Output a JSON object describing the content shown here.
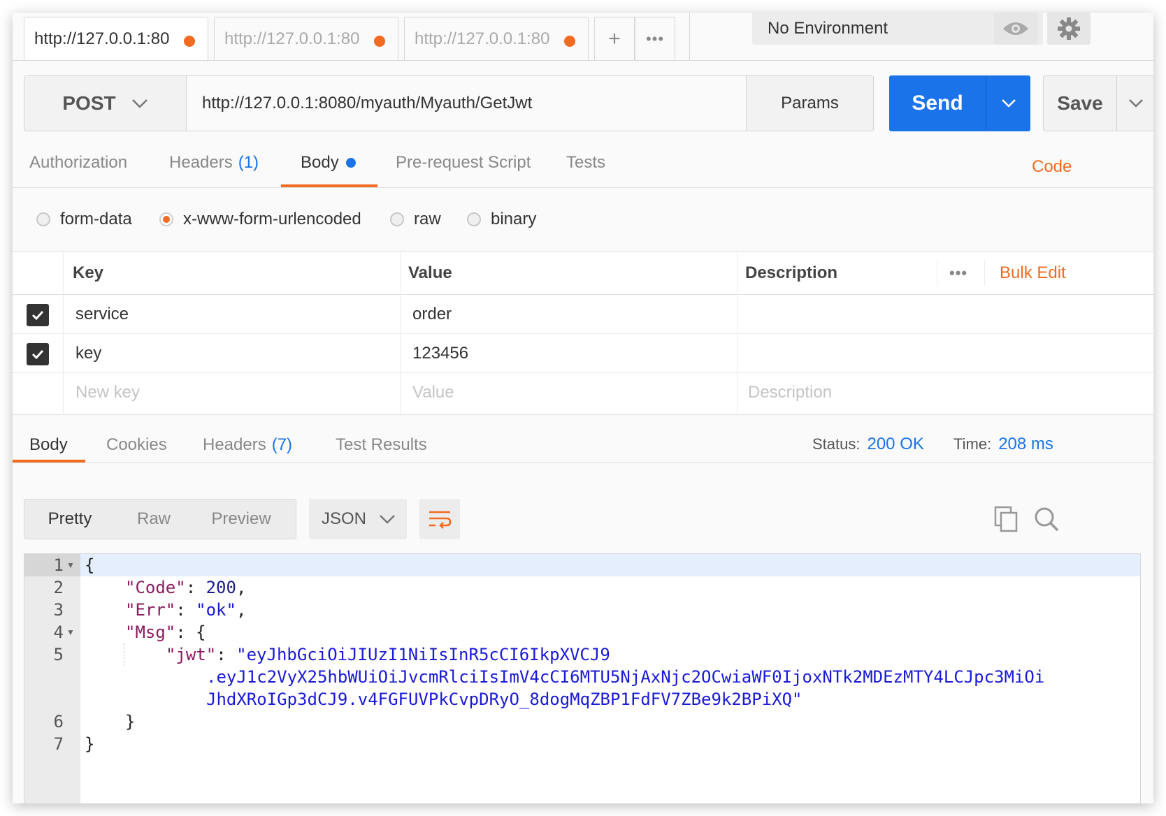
{
  "tabs": [
    {
      "label": "http://127.0.0.1:80",
      "active": true
    },
    {
      "label": "http://127.0.0.1:80",
      "active": false
    },
    {
      "label": "http://127.0.0.1:80",
      "active": false
    }
  ],
  "tab_actions": {
    "add": "+",
    "more": "•••"
  },
  "environment": {
    "selected": "No Environment"
  },
  "request": {
    "method": "POST",
    "url": "http://127.0.0.1:8080/myauth/Myauth/GetJwt",
    "params_label": "Params",
    "send_label": "Send",
    "save_label": "Save"
  },
  "request_tabs": {
    "authorization": "Authorization",
    "headers": "Headers",
    "headers_count": "(1)",
    "body": "Body",
    "prerequest": "Pre-request Script",
    "tests": "Tests",
    "code": "Code"
  },
  "body_modes": [
    {
      "label": "form-data",
      "selected": false
    },
    {
      "label": "x-www-form-urlencoded",
      "selected": true
    },
    {
      "label": "raw",
      "selected": false
    },
    {
      "label": "binary",
      "selected": false
    }
  ],
  "params_table": {
    "headers": {
      "key": "Key",
      "value": "Value",
      "description": "Description",
      "more": "•••",
      "bulk_edit": "Bulk Edit"
    },
    "rows": [
      {
        "checked": true,
        "key": "service",
        "value": "order",
        "description": ""
      },
      {
        "checked": true,
        "key": "key",
        "value": "123456",
        "description": ""
      }
    ],
    "placeholders": {
      "key": "New key",
      "value": "Value",
      "description": "Description"
    }
  },
  "response": {
    "tabs": {
      "body": "Body",
      "cookies": "Cookies",
      "headers": "Headers",
      "headers_count": "(7)",
      "test_results": "Test Results"
    },
    "status_label": "Status:",
    "status_value": "200 OK",
    "time_label": "Time:",
    "time_value": "208 ms",
    "views": {
      "pretty": "Pretty",
      "raw": "Raw",
      "preview": "Preview"
    },
    "format": "JSON"
  },
  "code_lines": {
    "l1": "{",
    "l2_key": "\"Code\"",
    "l2_val": "200",
    "l3_key": "\"Err\"",
    "l3_val": "\"ok\"",
    "l4_key": "\"Msg\"",
    "l4_rest": ": {",
    "l5_key": "\"jwt\"",
    "l5_val_a": "\"eyJhbGciOiJIUzI1NiIsInR5cCI6IkpXVCJ9",
    "l5_val_b": ".eyJ1c2VyX25hbWUiOiJvcmRlciIsImV4cCI6MTU5NjAxNjc2OCwiaWF0IjoxNTk2MDEzMTY4LCJpc3MiOi",
    "l5_val_c": "JhdXRoIGp3dCJ9.v4FGFUVPkCvpDRyO_8dogMqZBP1FdFV7ZBe9k2BPiXQ\"",
    "l6": "}",
    "l7": "}"
  },
  "line_numbers": [
    "1",
    "2",
    "3",
    "4",
    "5",
    "6",
    "7"
  ],
  "colors": {
    "accent": "#f26b21",
    "primary": "#1a73e8"
  }
}
